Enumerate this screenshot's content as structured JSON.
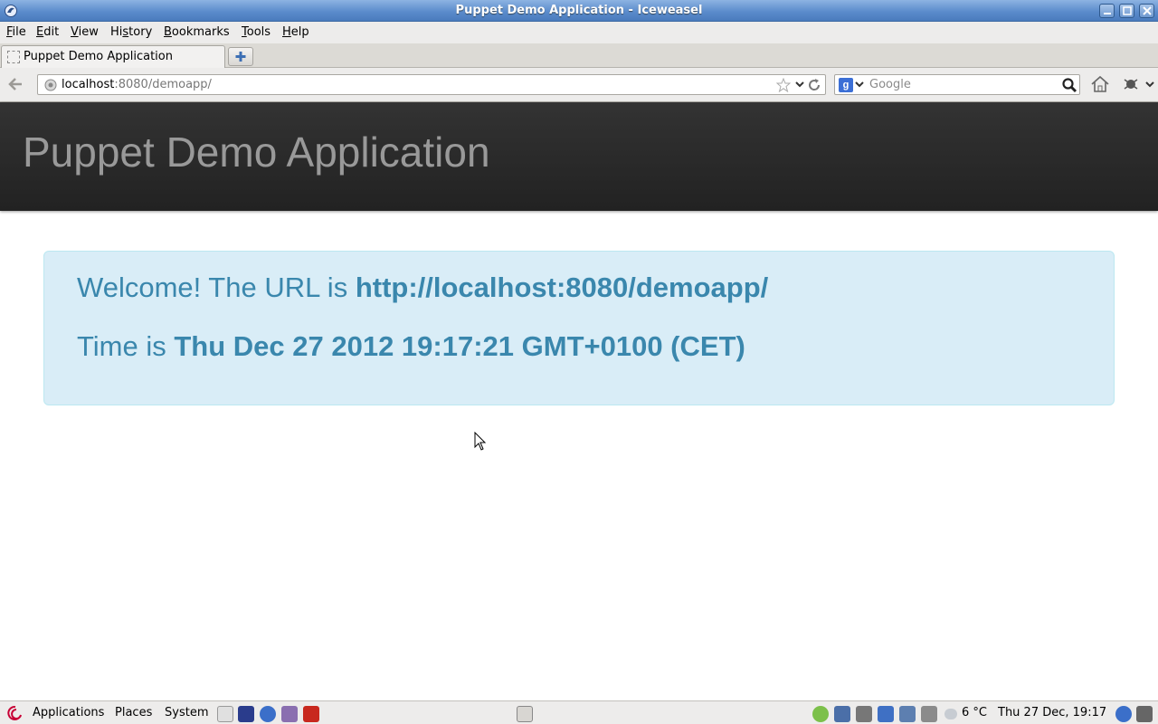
{
  "window": {
    "title": "Puppet Demo Application - Iceweasel"
  },
  "menubar": {
    "items": [
      {
        "label": "File",
        "underline": "F",
        "rest": "ile"
      },
      {
        "label": "Edit",
        "underline": "E",
        "rest": "dit"
      },
      {
        "label": "View",
        "underline": "V",
        "rest": "iew"
      },
      {
        "label": "History",
        "underline": "s",
        "pre": "Hi",
        "rest": "tory"
      },
      {
        "label": "Bookmarks",
        "underline": "B",
        "rest": "ookmarks"
      },
      {
        "label": "Tools",
        "underline": "T",
        "rest": "ools"
      },
      {
        "label": "Help",
        "underline": "H",
        "rest": "elp"
      }
    ]
  },
  "tabs": [
    {
      "label": "Puppet Demo Application"
    }
  ],
  "navbar": {
    "url_host": "localhost",
    "url_path": ":8080/demoapp/",
    "search_placeholder": "Google",
    "search_engine_glyph": "g"
  },
  "page": {
    "heading": "Puppet Demo Application",
    "welcome_prefix": "Welcome! The URL is ",
    "welcome_url": "http://localhost:8080/demoapp/",
    "time_prefix": "Time is ",
    "time_value": "Thu Dec 27 2012 19:17:21 GMT+0100 (CET)"
  },
  "taskbar": {
    "applications": "Applications",
    "places": "Places",
    "system": "System",
    "temperature": "6 °C",
    "clock": "Thu 27 Dec, 19:17"
  },
  "colors": {
    "alert_text": "#3a87ad",
    "alert_bg": "#d9edf7",
    "hero_bg": "#222222"
  }
}
